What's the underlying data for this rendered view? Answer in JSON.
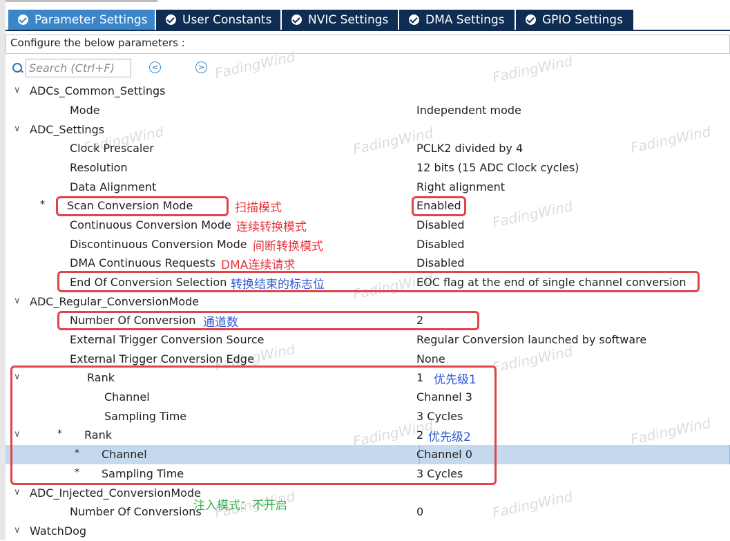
{
  "tabs": [
    {
      "label": "Parameter Settings",
      "active": true
    },
    {
      "label": "User Constants",
      "active": false
    },
    {
      "label": "NVIC Settings",
      "active": false
    },
    {
      "label": "DMA Settings",
      "active": false
    },
    {
      "label": "GPIO Settings",
      "active": false
    }
  ],
  "configure_label": "Configure the below parameters :",
  "search": {
    "placeholder": "Search (Ctrl+F)"
  },
  "nav": {
    "prev": "<",
    "next": ">"
  },
  "tree": {
    "common": {
      "label": "ADCs_Common_Settings",
      "mode_label": "Mode",
      "mode_value": "Independent mode"
    },
    "adc": {
      "label": "ADC_Settings",
      "clock_label": "Clock Prescaler",
      "clock_value": "PCLK2 divided by 4",
      "res_label": "Resolution",
      "res_value": "12 bits (15 ADC Clock cycles)",
      "align_label": "Data Alignment",
      "align_value": "Right alignment",
      "scan_label": "Scan Conversion Mode",
      "scan_value": "Enabled",
      "cont_label": "Continuous Conversion Mode",
      "cont_value": "Disabled",
      "discont_label": "Discontinuous Conversion Mode",
      "discont_value": "Disabled",
      "dma_label": "DMA Continuous Requests",
      "dma_value": "Disabled",
      "eoc_label": "End Of Conversion Selection",
      "eoc_value": "EOC flag at the end of single channel conversion"
    },
    "regular": {
      "label": "ADC_Regular_ConversionMode",
      "num_label": "Number Of Conversion",
      "num_value": "2",
      "src_label": "External Trigger Conversion Source",
      "src_value": "Regular Conversion launched by software",
      "edge_label": "External Trigger Conversion Edge",
      "edge_value": "None",
      "rank1": {
        "label": "Rank",
        "value": "1",
        "channel_label": "Channel",
        "channel_value": "Channel 3",
        "time_label": "Sampling Time",
        "time_value": "3 Cycles"
      },
      "rank2": {
        "label": "Rank",
        "value": "2",
        "channel_label": "Channel",
        "channel_value": "Channel 0",
        "time_label": "Sampling Time",
        "time_value": "3 Cycles"
      }
    },
    "injected": {
      "label": "ADC_Injected_ConversionMode",
      "num_label": "Number Of Conversions",
      "num_value": "0"
    },
    "watchdog": {
      "label": "WatchDog"
    }
  },
  "bullet": "*",
  "annotations": {
    "scan": "扫描模式",
    "cont": "连续转换模式",
    "discont": "间断转换模式",
    "dma": "DMA连续请求",
    "eoc": "转换结束的标志位",
    "num": "通道数",
    "prio1": "优先级1",
    "prio2": "优先级2",
    "injected": "注入模式：不开启"
  },
  "watermark": "FadingWind",
  "colors": {
    "tab_active": "#3a86c9",
    "tab_inactive": "#0f2d52",
    "highlight_box": "#e0434b",
    "selected_row": "#c5d9ee",
    "note_red": "#e8343c",
    "note_blue": "#2d58d6",
    "note_green": "#36b24c"
  }
}
